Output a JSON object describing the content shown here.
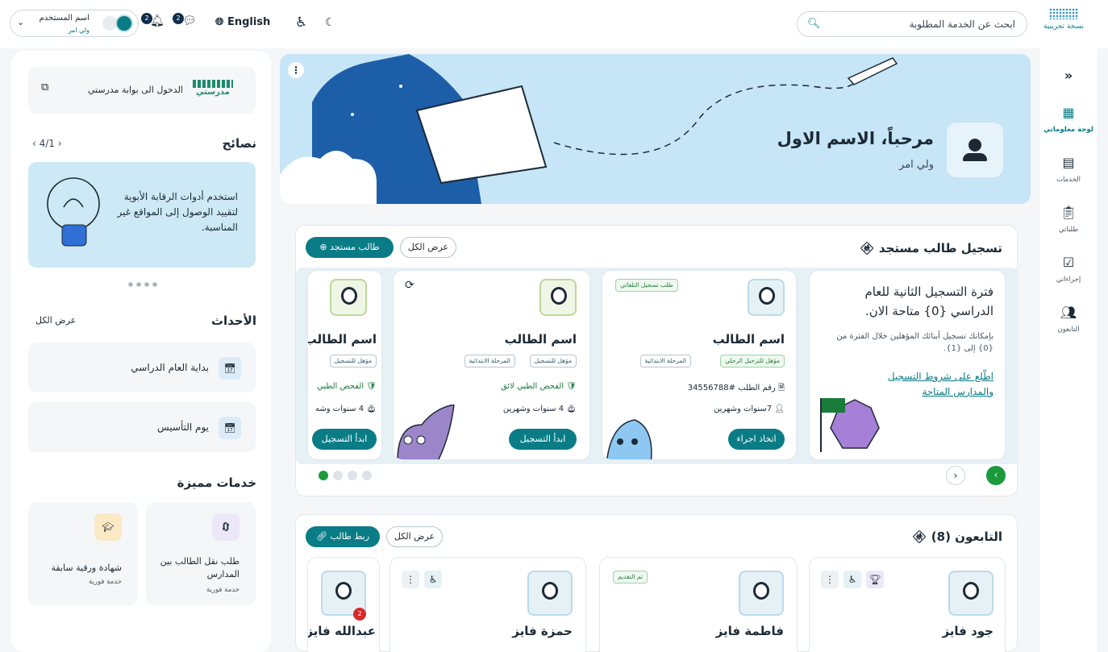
{
  "topbar": {
    "search_placeholder": "ابحث عن الخدمة المطلوبة",
    "language": "English",
    "user_name": "اسم المستخدم",
    "user_role": "ولي امر",
    "badge1": "2",
    "badge2": "2",
    "logo_text": "نسخة تجريبية"
  },
  "rail": {
    "collapse": "«",
    "items": [
      {
        "label": "لوحة معلوماتي",
        "icon": "dashboard-icon"
      },
      {
        "label": "الخدمات",
        "icon": "services-icon"
      },
      {
        "label": "طلباتي",
        "icon": "requests-icon"
      },
      {
        "label": "إجراءاتي",
        "icon": "actions-icon"
      },
      {
        "label": "التابعون",
        "icon": "dependents-icon"
      }
    ]
  },
  "hero": {
    "greeting": "مرحباً، الاسم الاول",
    "role": "ولي امر"
  },
  "registration": {
    "title": "تسجيل طالب مستجد",
    "view_all": "عرض الكل",
    "add_button": "طالب مستجد",
    "promo": {
      "heading": "فترة التسجيل الثانية للعام الدراسي {0} متاحة الان.",
      "body": "بإمكانك تسجيل أبنائك المؤهلين خلال الفترة من {0} إلى {1}.",
      "link": "اطّلع على شروط التسجيل والمدارس المتاحة"
    },
    "cards": [
      {
        "badge": "طلب تسجيل التلقائي",
        "name": "اسم الطالب",
        "tags": [
          "مؤهل للترحيل الرحلي",
          "المرحلة الابتدائية"
        ],
        "line1": "رقم الطلب #34556788",
        "line2": "7سنوات وشهرين",
        "button": "اتخاذ اجراء"
      },
      {
        "name": "اسم الطالب",
        "tags": [
          "مؤهل للتسجيل",
          "المرحلة الابتدائية"
        ],
        "line1": "الفحص الطبي لائق",
        "line2": "4 سنوات وشهرين",
        "button": "ابدأ التسجيل"
      },
      {
        "name": "اسم الطالب",
        "tags": [
          "مؤهل للتسجيل"
        ],
        "line1": "الفحص الطبي",
        "line2": "4 سنوات وشه",
        "button": "ابدأ التسجيل"
      }
    ]
  },
  "dependents": {
    "title": "التابعون (8)",
    "view_all": "عرض الكل",
    "link_button": "ربط طالب",
    "cards": [
      {
        "name": "جود فايز"
      },
      {
        "name": "فاطمة فايز",
        "badge": "تم التقديم"
      },
      {
        "name": "حمزة فايز"
      },
      {
        "name": "عبدالله فايز",
        "count": "2"
      }
    ]
  },
  "left": {
    "madrasati_login": "الدخول الى بوابة مدرستي",
    "madrasati_logo": "مدرستي",
    "tips_title": "نصائح",
    "tips_pager": "4/1",
    "tip_text": "استخدم أدوات الرقابة الأبوية لتقييد الوصول إلى المواقع غير المناسبة.",
    "events_title": "الأحداث",
    "events_view_all": "عرض الكل",
    "events": [
      "بداية العام الدراسي",
      "يوم التأسيس"
    ],
    "featured_title": "خدمات مميزة",
    "featured": [
      {
        "title": "طلب نقل الطالب بين المدارس",
        "sub": "خدمة فورية"
      },
      {
        "title": "شهادة ورقية سابقة",
        "sub": "خدمة فورية"
      }
    ]
  }
}
